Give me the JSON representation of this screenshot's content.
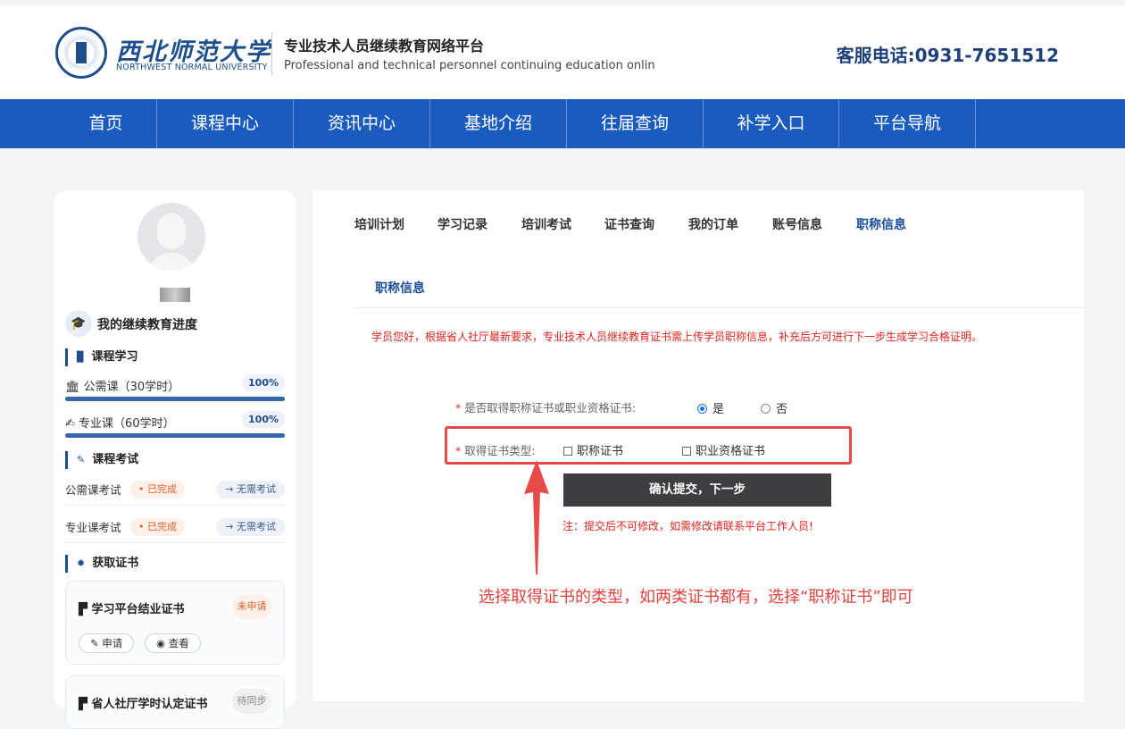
{
  "header": {
    "university_cn": "西北师范大学",
    "university_en": "NORTHWEST NORMAL UNIVERSITY",
    "platform_cn": "专业技术人员继续教育网络平台",
    "platform_en": "Professional and technical personnel continuing education onlin",
    "hotline": "客服电话:0931-7651512"
  },
  "nav": [
    "首页",
    "课程中心",
    "资讯中心",
    "基地介绍",
    "往届查询",
    "补学入口",
    "平台导航"
  ],
  "sidebar": {
    "progress_title": "我的继续教育进度",
    "course_section": "课程学习",
    "courses": [
      {
        "label": "公需课（30学时）",
        "percent": "100%",
        "fill": 1.0
      },
      {
        "label": "专业课（60学时）",
        "percent": "100%",
        "fill": 1.0
      }
    ],
    "exam_section": "课程考试",
    "exams": [
      {
        "label": "公需课考试",
        "status": "• 已完成",
        "action": "→ 无需考试"
      },
      {
        "label": "专业课考试",
        "status": "• 已完成",
        "action": "→ 无需考试"
      }
    ],
    "cert_section": "获取证书",
    "cert_card": {
      "title": "学习平台结业证书",
      "status": "未申请",
      "apply": "申请",
      "view": "查看"
    },
    "cert_card2": {
      "title": "省人社厅学时认定证书",
      "status": "待同步"
    }
  },
  "tabs": [
    "培训计划",
    "学习记录",
    "培训考试",
    "证书查询",
    "我的订单",
    "账号信息",
    "职称信息"
  ],
  "active_tab": "职称信息",
  "form": {
    "sub_title": "职称信息",
    "notice": "学员您好，根据省人社厅最新要求，专业技术人员继续教育证书需上传学员职称信息，补充后方可进行下一步生成学习合格证明。",
    "q1_label": "是否取得职称证书或职业资格证书:",
    "q1_yes": "是",
    "q1_no": "否",
    "q2_label": "取得证书类型:",
    "q2_opt1": "职称证书",
    "q2_opt2": "职业资格证书",
    "submit": "确认提交，下一步",
    "note": "注：提交后不可修改，如需修改请联系平台工作人员!"
  },
  "annotation": "选择取得证书的类型，如两类证书都有，选择“职称证书”即可",
  "colors": {
    "nav": "#1a5bbf",
    "accent": "#1a4c9a",
    "warning": "#e0231d"
  }
}
